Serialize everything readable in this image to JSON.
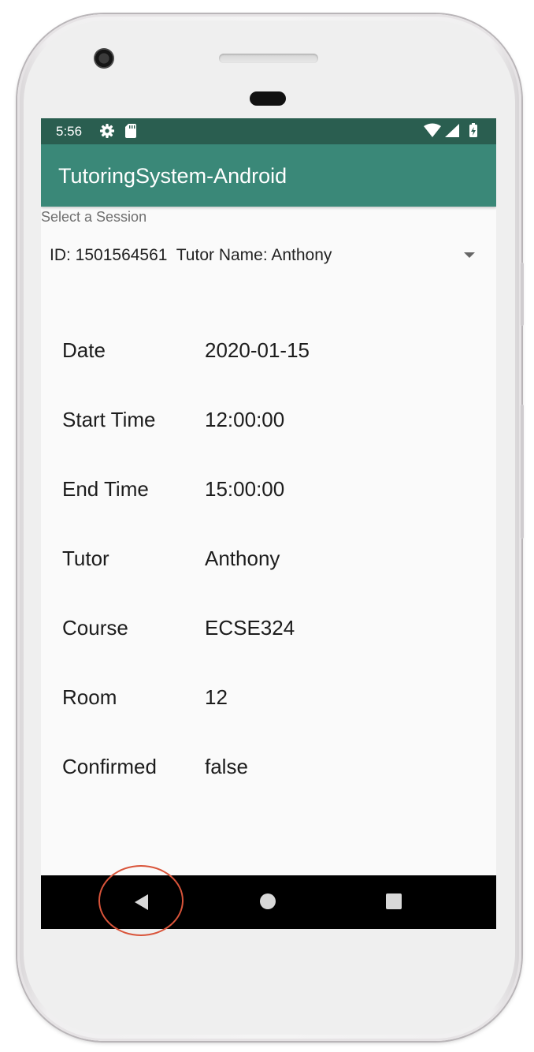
{
  "status_bar": {
    "time": "5:56",
    "icons": [
      "gear-icon",
      "sd-card-icon",
      "wifi-icon",
      "cell-signal-icon",
      "battery-charging-icon"
    ],
    "background_color": "#2a5e50"
  },
  "app_bar": {
    "title": "TutoringSystem-Android",
    "background_color": "#3a8878"
  },
  "session_selector": {
    "label": "Select a Session",
    "selected": "ID: 1501564561  Tutor Name: Anthony"
  },
  "details": [
    {
      "label": "Date",
      "value": "2020-01-15"
    },
    {
      "label": "Start Time",
      "value": "12:00:00"
    },
    {
      "label": "End Time",
      "value": "15:00:00"
    },
    {
      "label": "Tutor",
      "value": "Anthony"
    },
    {
      "label": "Course",
      "value": "ECSE324"
    },
    {
      "label": "Room",
      "value": "12"
    },
    {
      "label": "Confirmed",
      "value": "false"
    }
  ],
  "nav_bar": {
    "buttons": [
      "back-icon",
      "home-icon",
      "recents-icon"
    ],
    "highlighted": "back-icon",
    "highlight_color": "#d9543a"
  }
}
